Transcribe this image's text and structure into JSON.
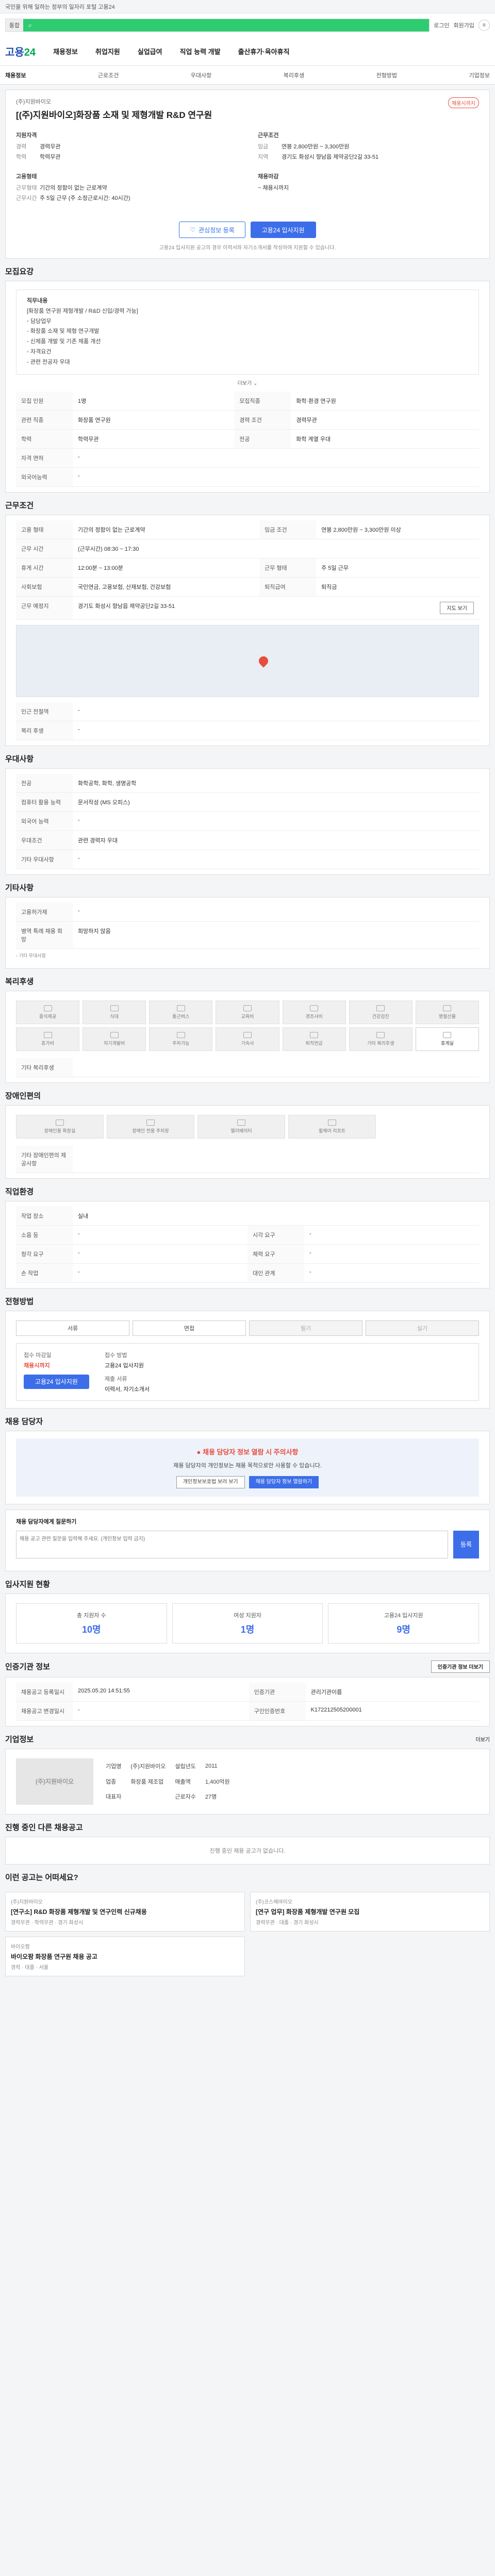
{
  "topbar": {
    "text": "국민을 위해 일하는 정부의 일자리 포털 고용24"
  },
  "search": {
    "scope": "통합",
    "placeholder": "",
    "login": "로그인",
    "register": "회원가입"
  },
  "gnb": {
    "logo_a": "고용",
    "logo_b": "24",
    "items": [
      "채용정보",
      "취업지원",
      "실업급여",
      "직업 능력 개발",
      "출산휴가·육아휴직"
    ]
  },
  "subnav": {
    "items": [
      "채용정보",
      "근로조건",
      "우대사항",
      "복리후생",
      "전형방법",
      "기업정보"
    ]
  },
  "job": {
    "company": "(주)지원바이오",
    "title": "[(주)지원바이오]화장품 소재 및 제형개발 R&D 연구원",
    "badge": "채용시까지",
    "req_h": "지원자격",
    "req": [
      [
        "경력",
        "경력무관"
      ],
      [
        "학력",
        "학력무관"
      ]
    ],
    "cond_h": "근무조건",
    "cond": [
      [
        "임금",
        "연봉 2,800만원 ~ 3,300만원"
      ],
      [
        "지역",
        "경기도 화성시 향남읍 제약공단2길 33-51"
      ]
    ],
    "emp_h": "고용형태",
    "emp": [
      [
        "근무형태",
        "기간의 정함이 없는 근로계약"
      ],
      [
        "근무시간",
        "주 5일 근무 (주 소정근로시간: 40시간)"
      ]
    ],
    "deadline_h": "채용마감",
    "deadline": "~ 채용시까지",
    "btn_scrap": "관심정보 등록",
    "btn_apply": "고용24 입사지원",
    "notice": "고용24 입사지원 공고의 경우 이력서와 자기소개서를 작성하여 지원할 수 있습니다."
  },
  "recruit": {
    "h": "모집요강",
    "body": [
      "직무내용",
      "[화장품 연구원 제형개발 / R&D 신입/경력 가능]",
      "",
      "◦ 담당업무",
      "- 화장품 소재 및 제형 연구개발",
      "- 신제품 개발 및 기존 제품 개선",
      "",
      "◦ 자격요건",
      "- 관련 전공자 우대"
    ],
    "more": "더보기",
    "rows": [
      [
        "모집 인원",
        "1명",
        "모집직종",
        "화학·환경 연구원"
      ],
      [
        "관련 직종",
        "화장품 연구원",
        "경력 조건",
        "경력무관"
      ],
      [
        "학력",
        "학력무관",
        "전공",
        "화학 계열 우대"
      ],
      [
        "자격 면허",
        "-",
        "",
        ""
      ],
      [
        "외국어능력",
        "-",
        "",
        ""
      ]
    ]
  },
  "work": {
    "h": "근무조건",
    "rows": [
      [
        "고용 형태",
        "기간의 정함이 없는 근로계약"
      ],
      [
        "임금 조건",
        "연봉 2,800만원 ~ 3,300만원 이상"
      ],
      [
        "근무 시간",
        "(근무시간) 08:30 ~ 17:30"
      ],
      [
        "휴게 시간",
        "12:00분 ~ 13:00분"
      ],
      [
        "근무 형태",
        "주 5일 근무"
      ],
      [
        "사회보험",
        "국민연금, 고용보험, 산재보험, 건강보험"
      ],
      [
        "퇴직급여",
        "퇴직금"
      ],
      [
        "근무 예정지",
        "경기도 화성시 향남읍 제약공단2길 33-51"
      ]
    ],
    "map_btn": "지도 보기",
    "extra": [
      [
        "인근 전철역",
        "-"
      ],
      [
        "복리 후생",
        "-"
      ]
    ]
  },
  "pref": {
    "h": "우대사항",
    "rows": [
      [
        "전공",
        "화학공학, 화학, 생명공학"
      ],
      [
        "컴퓨터 활용 능력",
        "문서작성 (MS 오피스)"
      ],
      [
        "외국어 능력",
        "-"
      ],
      [
        "우대조건",
        "관련 경력자 우대"
      ],
      [
        "기타 우대사항",
        "-"
      ]
    ]
  },
  "other": {
    "h": "기타사항",
    "rows": [
      [
        "고용허가제",
        "-"
      ],
      [
        "병역 특례 채용 희망",
        "희망하지 않음"
      ]
    ],
    "note": "◦ 기타 우대사항"
  },
  "welfare": {
    "h": "복리후생",
    "items": [
      "중식제공",
      "식대",
      "통근버스",
      "교육비",
      "경조사비",
      "건강검진",
      "명절선물",
      "휴가비",
      "자기개발비",
      "주차가능",
      "기숙사",
      "퇴직연금",
      "기타 복리후생",
      "휴게실"
    ],
    "etc_h": "기타 복리후생"
  },
  "disabled": {
    "h": "장애인편의",
    "items": [
      "장애인용 화장실",
      "장애인 전용 주차장",
      "엘리베이터",
      "휠체어 리프트"
    ],
    "etc_h": "기타 장애인편의 제공사항"
  },
  "worker": {
    "h": "직업환경",
    "rows": [
      [
        "작업 장소",
        "실내",
        "",
        ""
      ],
      [
        "소음 등",
        "-",
        "시각 요구",
        "-"
      ],
      [
        "청각 요구",
        "-",
        "체력 요구",
        "-"
      ],
      [
        "손 작업",
        "-",
        "대인 관계",
        "-"
      ]
    ]
  },
  "process": {
    "h": "전형방법",
    "steps": [
      "서류",
      "면접",
      "필기",
      "실기"
    ],
    "apply_h": "접수 마감일",
    "apply_v": "채용시까지",
    "method_h": "접수 방법",
    "method_v": "고용24 입사지원",
    "docs_h": "제출 서류",
    "docs_v": "이력서, 자기소개서",
    "btn": "고용24 입사지원"
  },
  "contact": {
    "h": "채용 담당자",
    "warn_title": "채용 담당자 정보 열람 시 주의사항",
    "warn_body": "채용 담당자의 개인정보는 채용 목적으로만 사용할 수 있습니다.",
    "btn1": "개인정보보호법 보러 보기",
    "btn2": "채용 담당자 정보 열람하기"
  },
  "qa": {
    "h": "채용 담당자에게 질문하기",
    "placeholder": "채용 공고 관련 질문을 입력해 주세요. (개인정보 입력 금지)",
    "btn": "등록"
  },
  "stats": {
    "h": "입사지원 현황",
    "items": [
      [
        "총 지원자 수",
        "10명"
      ],
      [
        "여성 지원자",
        "1명"
      ],
      [
        "고용24 입사지원",
        "9명"
      ]
    ]
  },
  "reg": {
    "h": "인증기관 정보",
    "btn": "인증기관 정보 더보기",
    "rows": [
      [
        "채용공고 등록일시",
        "2025.05.20 14:51:55",
        "인증기관",
        "관리기관이름"
      ],
      [
        "채용공고 변경일시",
        "-",
        "구인인증번호",
        "K172212505200001"
      ]
    ]
  },
  "company": {
    "h": "기업정보",
    "more": "더보기",
    "thumb": "(주)지원바이오",
    "rows": [
      [
        "기업명",
        "(주)지원바이오",
        "설립년도",
        "2011"
      ],
      [
        "업종",
        "화장품 제조업",
        "매출액",
        "1,400억원"
      ],
      [
        "대표자",
        "",
        "근로자수",
        "27명"
      ]
    ]
  },
  "related": {
    "h": "진행 중인 다른 채용공고",
    "empty": "진행 중인 채용 공고가 없습니다."
  },
  "recommend": {
    "h": "이런 공고는 어떠세요?",
    "items": [
      [
        "(주)지원바이오",
        "[연구소] R&D 화장품 제형개발 및 연구인력 신규채용",
        "경력무관 · 학력무관 · 경기 화성시"
      ],
      [
        "(주)코스메바이오",
        "[연구 업무] 화장품 제형개발 연구원 모집",
        "경력무관 · 대졸 · 경기 화성시"
      ],
      [
        "바이오팜",
        "바이오팜 화장품 연구원 채용 공고",
        "경력 · 대졸 · 서울"
      ]
    ]
  }
}
